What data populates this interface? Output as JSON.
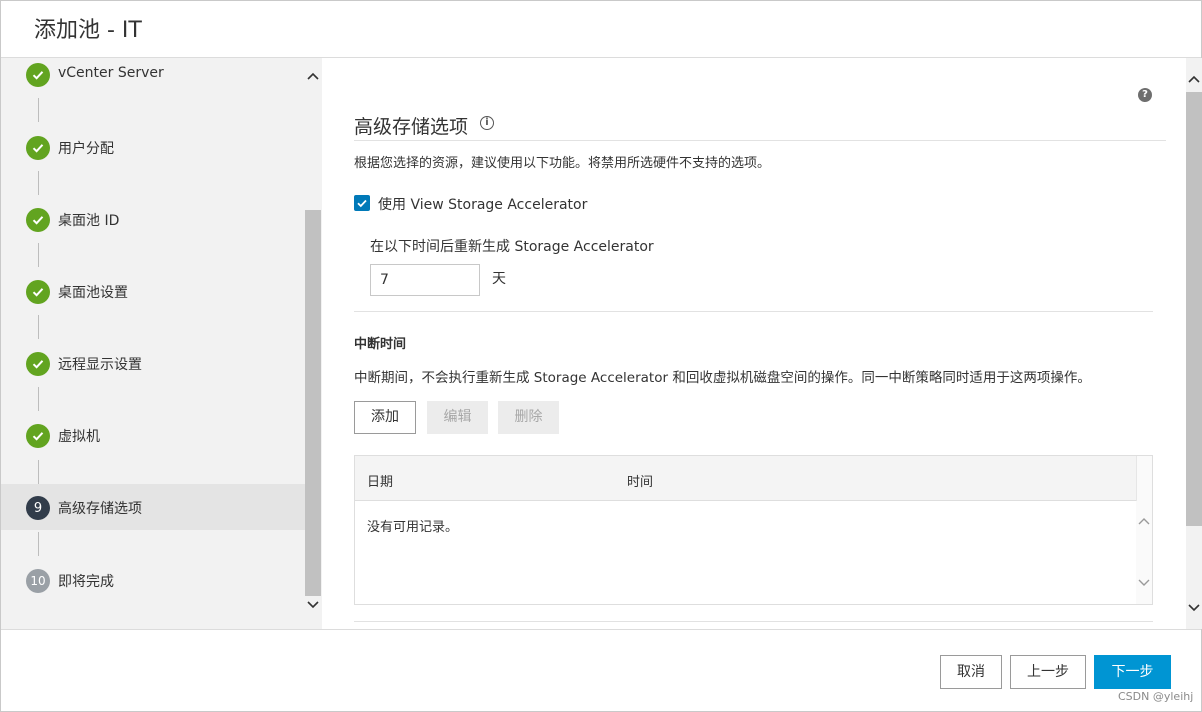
{
  "header": {
    "title": "添加池 - IT"
  },
  "sidebar": {
    "steps": [
      {
        "label": "vCenter Server",
        "status": "done"
      },
      {
        "label": "用户分配",
        "status": "done"
      },
      {
        "label": "桌面池 ID",
        "status": "done"
      },
      {
        "label": "桌面池设置",
        "status": "done"
      },
      {
        "label": "远程显示设置",
        "status": "done"
      },
      {
        "label": "虚拟机",
        "status": "done"
      },
      {
        "label": "高级存储选项",
        "status": "current",
        "number": "9"
      },
      {
        "label": "即将完成",
        "status": "todo",
        "number": "10"
      }
    ]
  },
  "main": {
    "help_icon": "?",
    "title": "高级存储选项",
    "description": "根据您选择的资源，建议使用以下功能。将禁用所选硬件不支持的选项。",
    "accelerator": {
      "checkbox_label": "使用 View Storage Accelerator",
      "checked": true,
      "regen_label": "在以下时间后重新生成 Storage Accelerator",
      "days_value": "7",
      "days_unit": "天"
    },
    "blackout": {
      "title": "中断时间",
      "description": "中断期间，不会执行重新生成 Storage Accelerator 和回收虚拟机磁盘空间的操作。同一中断策略同时适用于这两项操作。",
      "add_label": "添加",
      "edit_label": "编辑",
      "delete_label": "删除",
      "columns": [
        "日期",
        "时间"
      ],
      "empty_text": "没有可用记录。"
    }
  },
  "footer": {
    "cancel_label": "取消",
    "prev_label": "上一步",
    "next_label": "下一步",
    "watermark": "CSDN @yleihj"
  },
  "colors": {
    "done": "#62a420",
    "current": "#313c4a",
    "todo": "#9aa0a6",
    "primary": "#0095d3",
    "checkbox": "#0079b8"
  }
}
